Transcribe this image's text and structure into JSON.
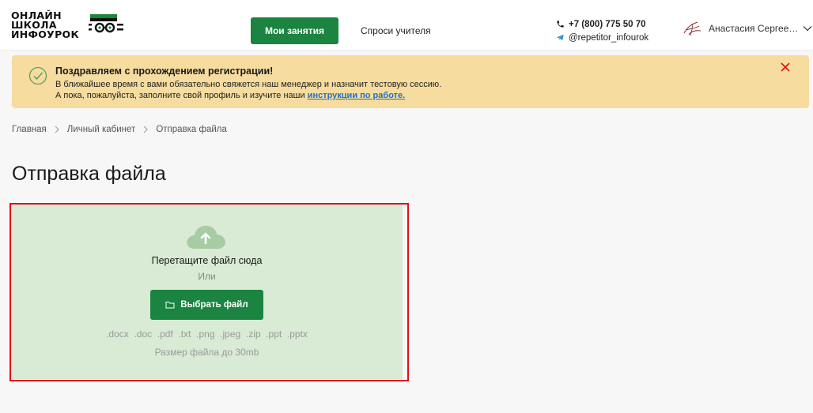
{
  "header": {
    "logo": {
      "line1": "ОНЛАЙН",
      "line2": "ШКОЛА",
      "line3": "ИНФОУРОК"
    },
    "nav": {
      "lessons_label": "Мои занятия",
      "ask_label": "Спроси учителя"
    },
    "contacts": {
      "phone": "+7 (800) 775 50 70",
      "telegram": "@repetitor_infourok"
    },
    "user": {
      "name": "Анастасия Сергее…"
    }
  },
  "notice": {
    "title": "Поздравляем с прохождением регистрации!",
    "line1": "В ближайшее время с вами обязательно свяжется наш менеджер и назначит тестовую сессию.",
    "line2_prefix": "А пока, пожалуйста, заполните свой профиль и изучите наши ",
    "line2_link": "инструкции по работе."
  },
  "breadcrumb": {
    "items": [
      "Главная",
      "Личный кабинет",
      "Отправка файла"
    ]
  },
  "page": {
    "title": "Отправка файла"
  },
  "upload": {
    "drag_text": "Перетащите файл сюда",
    "or_text": "Или",
    "choose_label": "Выбрать файл",
    "formats": ".docx  .doc  .pdf  .txt  .png  .jpeg  .zip  .ppt  .pptx",
    "size_limit": "Размер файла до 30mb"
  },
  "colors": {
    "brand_green": "#1a8440",
    "notice_bg": "#f6dc9f",
    "upload_bg": "#d9ead5",
    "highlight_red": "#e0121b",
    "link_blue": "#1f72c4"
  },
  "icons": [
    "logo-mark-icon",
    "phone-icon",
    "telegram-icon",
    "avatar-icon",
    "chevron-down-icon",
    "check-circle-icon",
    "close-icon",
    "chevron-right-icon",
    "cloud-upload-icon",
    "folder-icon"
  ]
}
